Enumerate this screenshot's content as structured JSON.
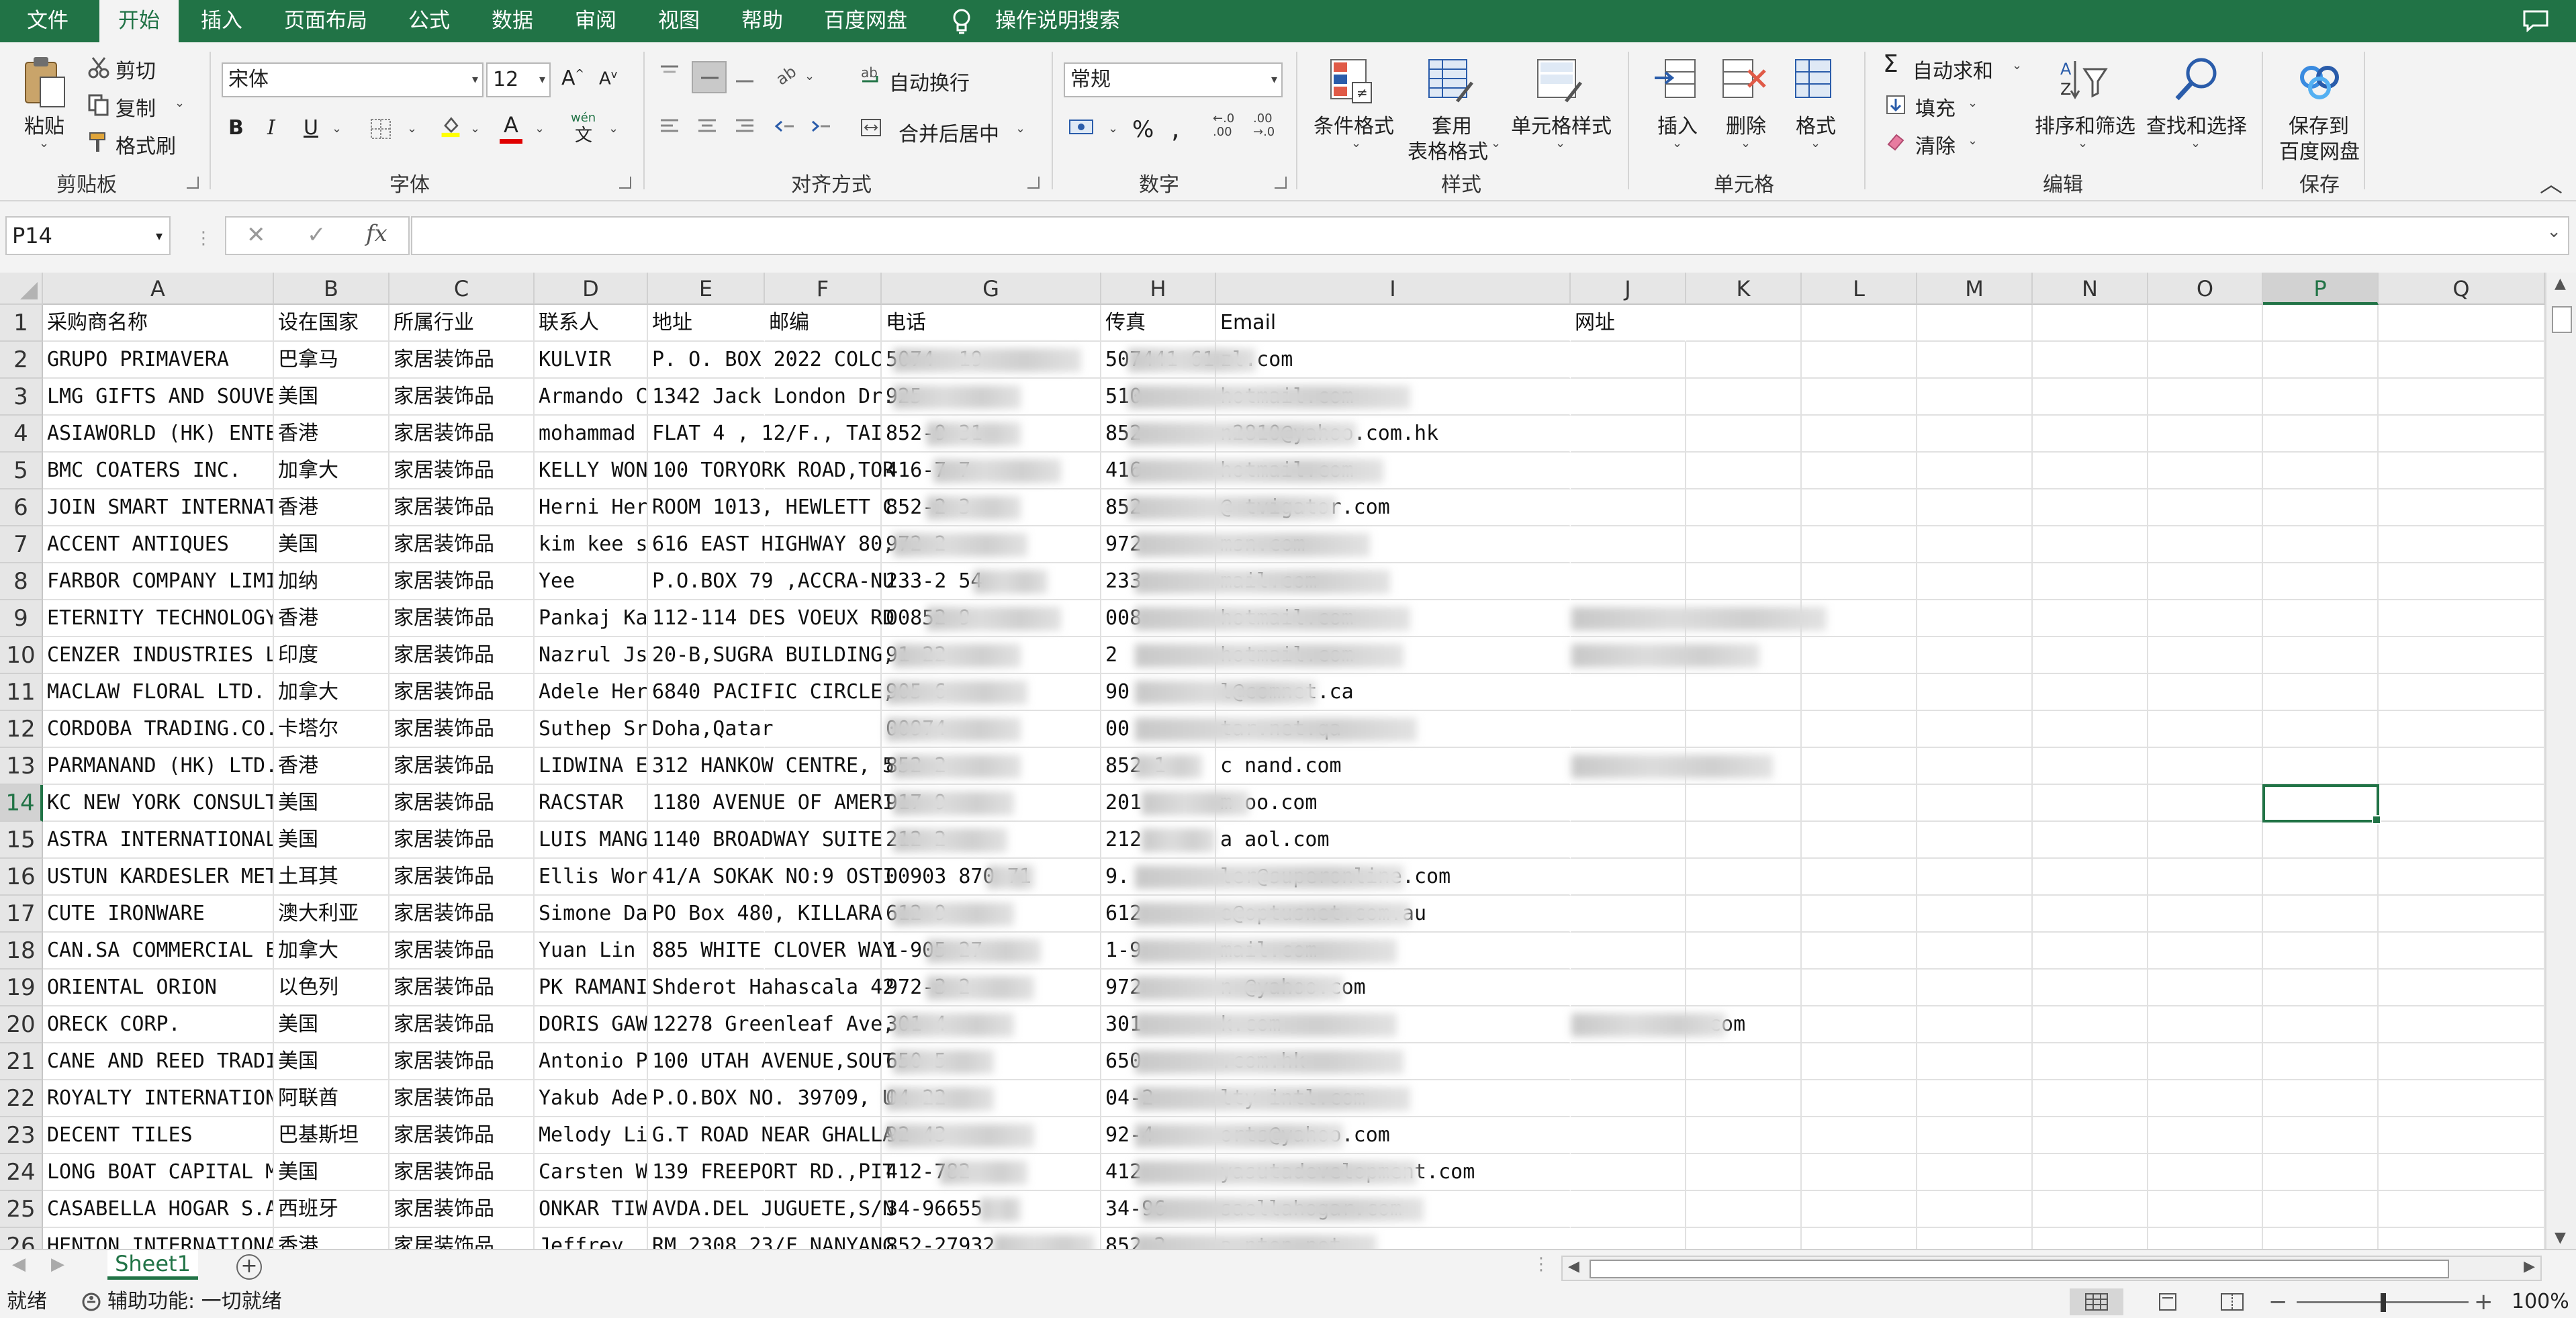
{
  "menu": {
    "tabs": [
      "文件",
      "开始",
      "插入",
      "页面布局",
      "公式",
      "数据",
      "审阅",
      "视图",
      "帮助",
      "百度网盘"
    ],
    "active": "开始",
    "search_label": "操作说明搜索"
  },
  "ribbon": {
    "clipboard": {
      "paste": "粘贴",
      "cut": "剪切",
      "copy": "复制",
      "format_painter": "格式刷",
      "label": "剪贴板"
    },
    "font": {
      "name": "宋体",
      "size": "12",
      "label": "字体",
      "phonetic": "wén"
    },
    "alignment": {
      "wrap": "自动换行",
      "merge": "合并后居中",
      "label": "对齐方式"
    },
    "number": {
      "format": "常规",
      "label": "数字"
    },
    "styles": {
      "conditional": "条件格式",
      "table_format_line1": "套用",
      "table_format_line2": "表格格式",
      "cell_style": "单元格样式",
      "label": "样式"
    },
    "cells": {
      "insert": "插入",
      "delete": "删除",
      "format": "格式",
      "label": "单元格"
    },
    "editing": {
      "autosum": "自动求和",
      "fill": "填充",
      "clear": "清除",
      "sort": "排序和筛选",
      "find": "查找和选择",
      "label": "编辑"
    },
    "save": {
      "line1": "保存到",
      "line2": "百度网盘",
      "label": "保存"
    }
  },
  "formula_bar": {
    "name_box": "P14",
    "fx": "fx",
    "value": ""
  },
  "grid": {
    "columns": [
      "A",
      "B",
      "C",
      "D",
      "E",
      "F",
      "G",
      "H",
      "I",
      "J",
      "K",
      "L",
      "M",
      "N",
      "O",
      "P",
      "Q"
    ],
    "selected_column": "P",
    "selected_row": 14,
    "rows": [
      {
        "n": 1,
        "A": "采购商名称",
        "B": "设在国家",
        "C": "所属行业",
        "D": "联系人",
        "E": "地址",
        "F": "邮编",
        "G": "电话",
        "H": "传真",
        "I": "Email",
        "J": "网址"
      },
      {
        "n": 2,
        "A": "GRUPO PRIMAVERA",
        "B": "巴拿马",
        "C": "家居装饰品",
        "D": "KULVIR",
        "E": "P. O. BOX 2022  COLC",
        "G": "5074  -19",
        "H": "507441-616",
        "I": "zl.com"
      },
      {
        "n": 3,
        "A": "LMG GIFTS AND SOUVEN",
        "B": "美国",
        "C": "家居装饰品",
        "D": "Armando C",
        "E": "1342 Jack London Dr.",
        "G": "925-",
        "H": "510-",
        "I": "hotmail.com"
      },
      {
        "n": 4,
        "A": "ASIAWORLD (HK) ENTER",
        "B": "香港",
        "C": "家居装饰品",
        "D": "mohammad",
        "E": "FLAT 4 , 12/F., TAI",
        "G": "852-9 31",
        "H": "852-",
        "I": "n2810@yahoo.com.hk"
      },
      {
        "n": 5,
        "A": "BMC COATERS INC.",
        "B": "加拿大",
        "C": "家居装饰品",
        "D": "KELLY WONG",
        "E": "100 TORYORK ROAD,TOR",
        "G": "416-7 7",
        "H": "416-",
        "I": "hotmail.com"
      },
      {
        "n": 6,
        "A": "JOIN SMART INTERNATI",
        "B": "香港",
        "C": "家居装饰品",
        "D": "Herni Her",
        "E": "ROOM 1013, HEWLETT C",
        "G": "852-2 3",
        "H": "852",
        "I": "@ tvigator.com"
      },
      {
        "n": 7,
        "A": "ACCENT ANTIQUES",
        "B": "美国",
        "C": "家居装饰品",
        "D": "kim kee s",
        "E": "616 EAST HIGHWAY 80,",
        "G": "972-2",
        "H": "972",
        "I": "msn.com"
      },
      {
        "n": 8,
        "A": "FARBOR COMPANY LIMIT",
        "B": "加纳",
        "C": "家居装饰品",
        "D": "Yee",
        "E": "P.O.BOX 79 ,ACCRA-NU",
        "G": "233-2        54",
        "H": "233",
        "I": "mail.com"
      },
      {
        "n": 9,
        "A": "ETERNITY  TECHNOLOGY",
        "B": "香港",
        "C": "家居装饰品",
        "D": "Pankaj Kal",
        "E": "112-114 DES VOEUX RD",
        "G": "00852         9",
        "H": "008",
        "I": "hotmail.com"
      },
      {
        "n": 10,
        "A": "CENZER INDUSTRIES LI",
        "B": "印度",
        "C": "家居装饰品",
        "D": "Nazrul Js",
        "E": "20-B,SUGRA BUILDING,",
        "G": "91-22",
        "H": "2",
        "I": "hotmail.com"
      },
      {
        "n": 11,
        "A": "MACLAW FLORAL LTD.",
        "B": "加拿大",
        "C": "家居装饰品",
        "D": "Adele Her",
        "E": "6840 PACIFIC CIRCLE,",
        "G": "905-6",
        "H": "90",
        "I": "l@comnet.ca"
      },
      {
        "n": 12,
        "A": "CORDOBA TRADING.CO.",
        "B": "卡塔尔",
        "C": "家居装饰品",
        "D": "Suthep Sr",
        "E": "Doha,Qatar",
        "G": "00974",
        "H": "00",
        "I": "tar.net.qa"
      },
      {
        "n": 13,
        "A": "PARMANAND (HK) LTD.",
        "B": "香港",
        "C": "家居装饰品",
        "D": "LIDWINA E",
        "E": "312 HANKOW CENTRE, 5",
        "G": "852-2",
        "H": "852   1",
        "I": "c           nand.com"
      },
      {
        "n": 14,
        "A": "KC NEW YORK CONSULTI",
        "B": "美国",
        "C": "家居装饰品",
        "D": "RACSTAR",
        "E": "1180 AVENUE OF AMERI",
        "G": "917-9",
        "H": "201",
        "I": "m           oo.com"
      },
      {
        "n": 15,
        "A": "ASTRA INTERNATIONAL",
        "B": "美国",
        "C": "家居装饰品",
        "D": "LUIS MANGI",
        "E": "1140 BROADWAY SUITE",
        "G": "212-2",
        "H": "212",
        "I": "a           aol.com"
      },
      {
        "n": 16,
        "A": "USTUN KARDESLER META",
        "B": "土耳其",
        "C": "家居装饰品",
        "D": "Ellis Wor",
        "E": "41/A SOKAK NO:9 OSTI",
        "G": "00903      870-71",
        "H": "9.",
        "I": "ler@superonline.com"
      },
      {
        "n": 17,
        "A": "CUTE IRONWARE",
        "B": "澳大利亚",
        "C": "家居装饰品",
        "D": "Simone Dar",
        "E": "PO Box 480, KILLARA",
        "G": "612-9",
        "H": "612",
        "I": "e@optusnet.com.au"
      },
      {
        "n": 18,
        "A": "CAN.SA COMMERCIAL ES",
        "B": "加拿大",
        "C": "家居装饰品",
        "D": "Yuan Lin",
        "E": "885 WHITE CLOVER WAY",
        "G": "1-905     27",
        "H": "1-9",
        "I": "mail.com"
      },
      {
        "n": 19,
        "A": "ORIENTAL ORION",
        "B": "以色列",
        "C": "家居装饰品",
        "D": "PK RAMANI",
        "E": "Shderot Hahascala 42",
        "G": "972-3      2",
        "H": "972",
        "I": "n @yahoo.com"
      },
      {
        "n": 20,
        "A": "ORECK CORP.",
        "B": "美国",
        "C": "家居装饰品",
        "D": "DORIS GAW",
        "E": "12278 Greenleaf Ave,",
        "G": "301-4",
        "H": "301-",
        "I": "k.com"
      },
      {
        "n": 21,
        "A": "CANE AND REED TRADIN",
        "B": "美国",
        "C": "家居装饰品",
        "D": "Antonio Pe",
        "E": "100 UTAH AVENUE,SOUT",
        "G": "650-5",
        "H": "650-",
        "I": ".com.hk"
      },
      {
        "n": 22,
        "A": "ROYALTY INTERNATIONA",
        "B": "阿联酋",
        "C": "家居装饰品",
        "D": "Yakub Ade",
        "E": "P.O.BOX NO. 39709, U",
        "G": "04-22",
        "H": "04-2",
        "I": "lty-intl.com"
      },
      {
        "n": 23,
        "A": "DECENT TILES",
        "B": "巴基斯坦",
        "C": "家居装饰品",
        "D": "Melody Li",
        "E": "G.T ROAD NEAR GHALLA",
        "G": "92-43",
        "H": "92-4",
        "I": "orts@yahoo.com"
      },
      {
        "n": 24,
        "A": "LONG BOAT CAPITAL MA",
        "B": "美国",
        "C": "家居装饰品",
        "D": "Carsten W",
        "E": "139 FREEPORT RD.,PIT",
        "G": "412-782",
        "H": "412-",
        "I": "yasutadevelopment.com"
      },
      {
        "n": 25,
        "A": "CASABELLA HOGAR S.A.",
        "B": "西班牙",
        "C": "家居装饰品",
        "D": "ONKAR TIWA",
        "E": "AVDA.DEL JUGUETE,S/N",
        "G": "34-96655",
        "H": "34-96",
        "I": "saellahogar.com"
      },
      {
        "n": 26,
        "A": "HENTON INTERNATIONAL",
        "B": "香港",
        "C": "家居装饰品",
        "D": "Jeffrey",
        "E": "RM 2308 23/F NANYANG",
        "G": "852-27932",
        "H": "852-2",
        "I": "a  nton.net"
      }
    ],
    "j_extra": {
      "20": "com"
    }
  },
  "sheets": {
    "tabs": [
      "Sheet1"
    ]
  },
  "status": {
    "ready": "就绪",
    "accessibility": "辅助功能: 一切就绪",
    "zoom": "100%"
  }
}
